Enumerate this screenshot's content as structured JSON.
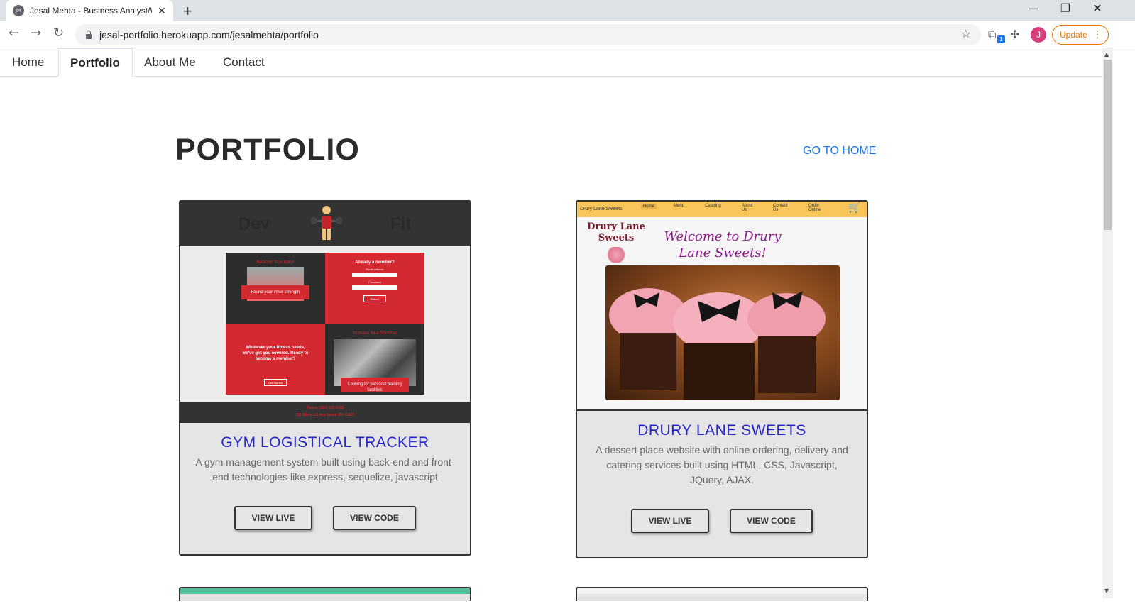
{
  "browser": {
    "tab_title": "Jesal Mehta - Business Analyst/W",
    "tab_favicon": "JM",
    "url": "jesal-portfolio.herokuapp.com/jesalmehta/portfolio",
    "avatar_letter": "J",
    "update_label": "Update",
    "extension_badge": "1"
  },
  "nav": {
    "items": [
      "Home",
      "Portfolio",
      "About Me",
      "Contact"
    ],
    "active": "Portfolio"
  },
  "page": {
    "title": "PORTFOLIO",
    "home_link": "GO TO HOME"
  },
  "projects": [
    {
      "title": "GYM LOGISTICAL TRACKER",
      "description": "A gym management system built using back-end and front-end technologies like express, sequelize, javascript",
      "live_label": "VIEW LIVE",
      "code_label": "VIEW CODE",
      "preview": {
        "logo_left": "Dev",
        "logo_right": "Fit",
        "q1_title": "Refactor Your Body!",
        "q1_caption": "Found your inner strength",
        "q2_title": "Already a member?",
        "q2_field1": "Email address",
        "q2_field2": "Password",
        "q2_button": "Submit",
        "q3_text": "Whatever your fitness needs, we've got you covered. Ready to become a member?",
        "q3_button": "Get Started",
        "q4_title": "Increase Your Stamina!",
        "q4_caption": "Looking for personal training facilities",
        "footer_phone": "Phone: (555) 555-5555",
        "footer_address": "111 Black Lift Ave Salem MA 03879"
      }
    },
    {
      "title": "DRURY LANE SWEETS",
      "description": "A dessert place website with online ordering, delivery and catering services built using HTML, CSS, Javascript, JQuery, AJAX.",
      "live_label": "VIEW LIVE",
      "code_label": "VIEW CODE",
      "preview": {
        "brand": "Drury Lane Sweets",
        "nav": [
          "Home",
          "Menu",
          "Catering",
          "About Us",
          "Contact Us",
          "Order Online"
        ],
        "logo": "Drury Lane Sweets",
        "welcome": "Welcome to Drury Lane Sweets!"
      }
    }
  ],
  "colors": {
    "link_blue": "#1a73e8",
    "card_title": "#2525c9",
    "card_bg": "#e5e5e5",
    "gym_red": "#d32a32",
    "drury_yellow": "#f9c65c"
  }
}
